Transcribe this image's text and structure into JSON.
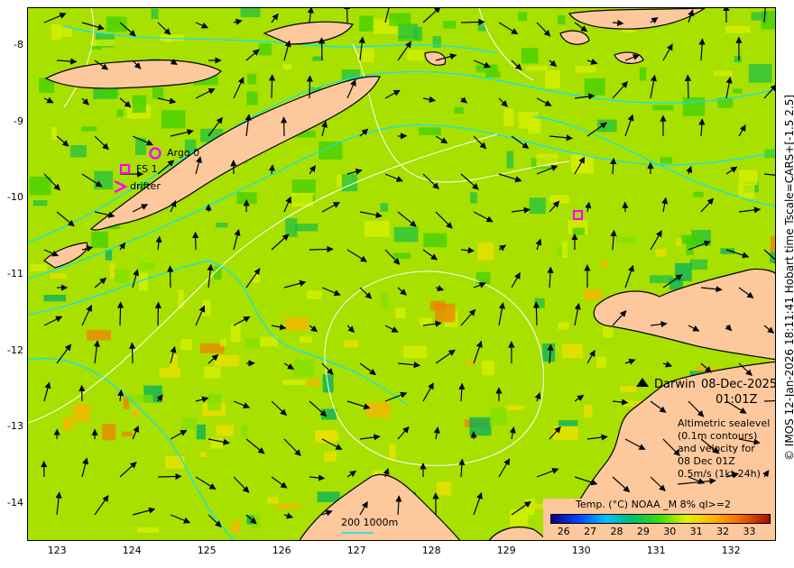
{
  "map": {
    "lat_labels": [
      "-8",
      "-9",
      "-10",
      "-11",
      "-12",
      "-13",
      "-14"
    ],
    "lon_labels": [
      "123",
      "124",
      "125",
      "126",
      "127",
      "128",
      "129",
      "130",
      "131",
      "132"
    ],
    "extent": {
      "lon": [
        122.6,
        132.6
      ],
      "lat": [
        -14.5,
        -7.5
      ]
    },
    "side_caption": "© IMOS 12-Jan-2026 18:11:41 Hobart time Tscale=CARS+[-1.5 2.5]",
    "location": "Darwin",
    "date": "08-Dec-2025",
    "time": "01:01Z",
    "altimetry_note": [
      "Altimetric sealevel",
      "(0.1m contours)",
      "and velocity for",
      "08 Dec 01Z",
      "0.5m/s (1kt 24h)"
    ],
    "depth_scale_label": "200  1000m",
    "colorbar_title": "Temp. (°C) NOAA _M 8% ql>=2",
    "colorbar_ticks": [
      "26",
      "27",
      "28",
      "29",
      "30",
      "31",
      "32",
      "33"
    ],
    "colorbar_range": [
      25.5,
      33.8
    ]
  },
  "markers": {
    "argo": "Argo 0",
    "fs": "FS 1",
    "drifter": "drifter",
    "marker_color": "#ff00ff"
  },
  "colors": {
    "land": "#fcc89c",
    "sst_dominant": "#a0e000",
    "shelf_contour": "#00e5ff",
    "sealevel_contour": "#ffffff"
  }
}
